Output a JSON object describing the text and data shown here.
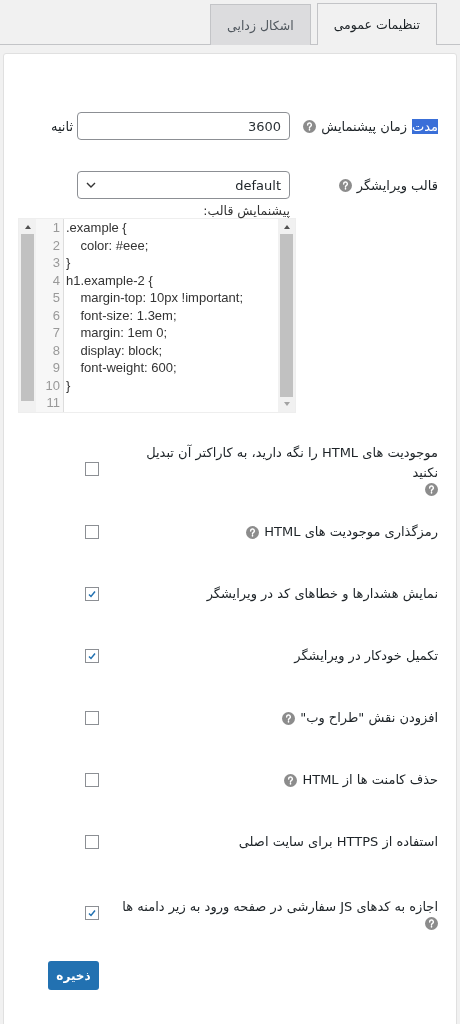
{
  "tabs": [
    {
      "label": "تنظیمات عمومی",
      "selected": true
    },
    {
      "label": "اشکال زدایی",
      "selected": false
    }
  ],
  "preview_duration": {
    "selected_text": "مدت",
    "label": "زمان پیشنمایش",
    "help": true,
    "value": "3600",
    "unit": "ثانیه"
  },
  "editor_theme": {
    "label": "قالب ویرایشگر",
    "help": true,
    "value": "default",
    "preview_label": "پیشنمایش قالب:"
  },
  "code_preview": {
    "lines": [
      {
        "number": "1",
        "text": ".example {"
      },
      {
        "number": "2",
        "text": "    color: #eee;"
      },
      {
        "number": "3",
        "text": "}"
      },
      {
        "number": "4",
        "text": "h1.example-2 {"
      },
      {
        "number": "5",
        "text": "    margin-top: 10px !important;"
      },
      {
        "number": "6",
        "text": "    font-size: 1.3em;"
      },
      {
        "number": "7",
        "text": "    margin: 1em 0;"
      },
      {
        "number": "8",
        "text": "    display: block;"
      },
      {
        "number": "9",
        "text": "    font-weight: 600;"
      },
      {
        "number": "10",
        "text": "}"
      },
      {
        "number": "11"
      }
    ]
  },
  "options": [
    {
      "label": "موجودیت های HTML را نگه دارید، به کاراکتر آن تبدیل نکنید",
      "help": true,
      "checked": false
    },
    {
      "label": "رمزگذاری موجودیت های HTML",
      "help": true,
      "checked": false
    },
    {
      "label": "نمایش هشدارها و خطاهای کد در ویرایشگر",
      "help": false,
      "checked": true
    },
    {
      "label": "تکمیل خودکار در ویرایشگر",
      "help": false,
      "checked": true
    },
    {
      "label": "افزودن نقش \"طراح وب\"",
      "help": true,
      "checked": false
    },
    {
      "label": "حذف کامنت ها از HTML",
      "help": true,
      "checked": false
    },
    {
      "label": "استفاده از HTTPS برای سایت اصلی",
      "help": false,
      "checked": false
    },
    {
      "label": "اجازه به کدهای JS سفارشی در صفحه ورود به زیر دامنه ها",
      "help": true,
      "checked": true
    }
  ],
  "save_button": "ذخیره"
}
